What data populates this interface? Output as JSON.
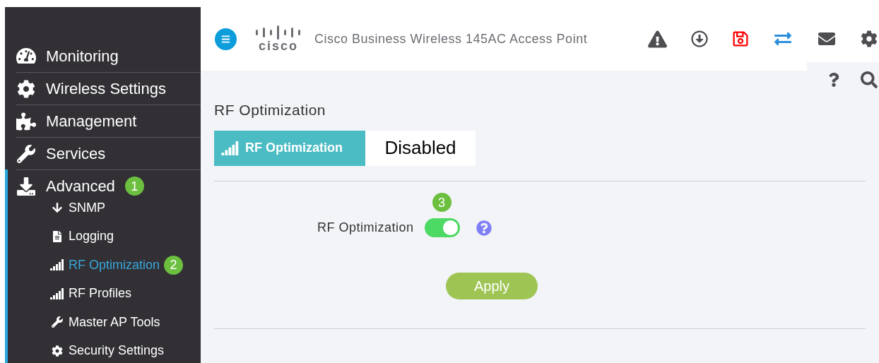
{
  "sidebar": {
    "items": [
      {
        "label": "Monitoring",
        "selected": false
      },
      {
        "label": "Wireless Settings",
        "selected": false
      },
      {
        "label": "Management",
        "selected": false
      },
      {
        "label": "Services",
        "selected": false
      },
      {
        "label": "Advanced",
        "selected": true,
        "expanded": true,
        "badge": "1",
        "children": [
          {
            "label": "SNMP",
            "selected": false
          },
          {
            "label": "Logging",
            "selected": false
          },
          {
            "label": "RF Optimization",
            "selected": true,
            "badge": "2"
          },
          {
            "label": "RF Profiles",
            "selected": false
          },
          {
            "label": "Master AP Tools",
            "selected": false
          },
          {
            "label": "Security Settings",
            "selected": false
          }
        ]
      }
    ]
  },
  "header": {
    "logo": "cisco",
    "title": "Cisco Business Wireless 145AC Access Point"
  },
  "page": {
    "title": "RF Optimization",
    "status_tab": {
      "label": "RF Optimization",
      "value": "Disabled"
    },
    "setting": {
      "label": "RF Optimization",
      "on": true,
      "badge": "3"
    },
    "apply_button": "Apply"
  }
}
